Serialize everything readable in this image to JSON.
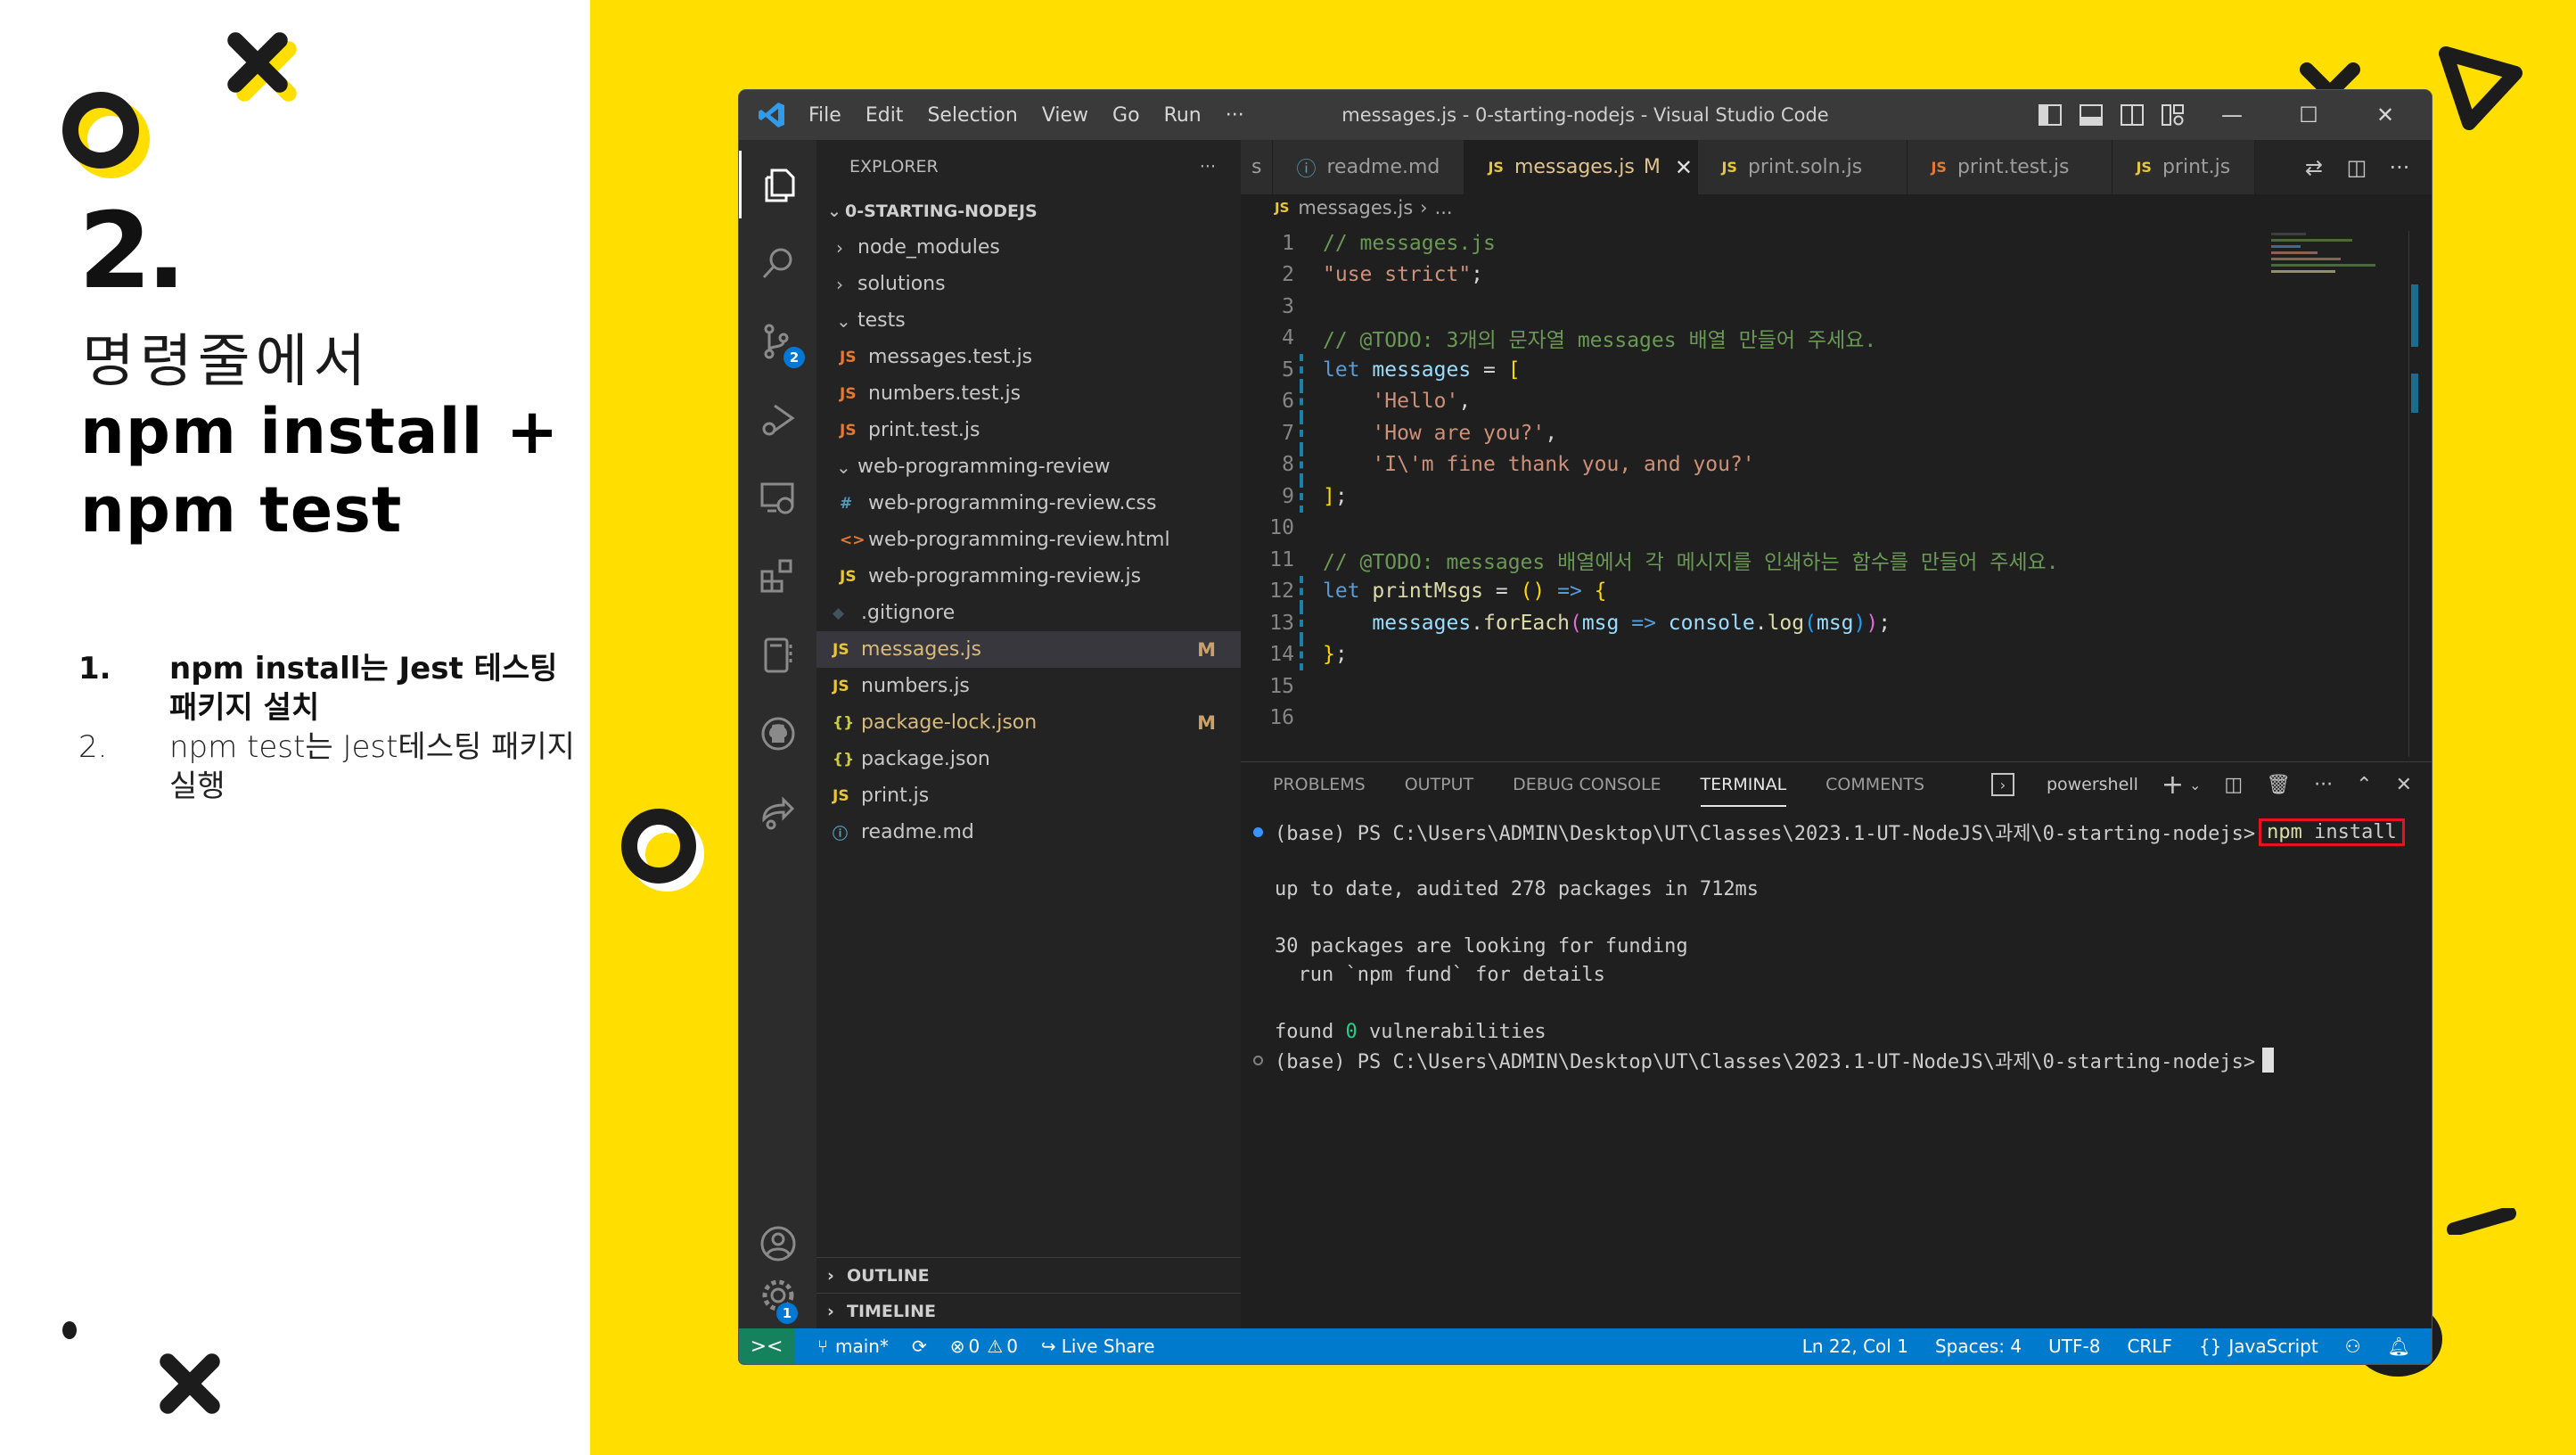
{
  "slide": {
    "number": "2.",
    "subtitle": "명령줄에서",
    "title_lines": [
      "npm install +",
      "npm test"
    ],
    "bullets": [
      {
        "num": "1.",
        "text": "npm install는 Jest 테스팅 패키지 설치",
        "weight": "bold"
      },
      {
        "num": "2.",
        "text": "npm test는 Jest테스팅 패키지 실행",
        "weight": "light"
      }
    ],
    "colors": {
      "background": "#FFDE00",
      "panel": "#FFFFFF",
      "ink": "#1C1C1C"
    }
  },
  "window": {
    "title": "messages.js - 0-starting-nodejs - Visual Studio Code",
    "menu": [
      "File",
      "Edit",
      "Selection",
      "View",
      "Go",
      "Run",
      "···"
    ],
    "controls": {
      "minimize": "—",
      "maximize": "☐",
      "close": "✕"
    }
  },
  "activity_bar": {
    "items": [
      {
        "name": "explorer",
        "active": true
      },
      {
        "name": "search"
      },
      {
        "name": "source-control",
        "badge": "2"
      },
      {
        "name": "run-debug"
      },
      {
        "name": "remote-explorer"
      },
      {
        "name": "extensions"
      },
      {
        "name": "notebook"
      },
      {
        "name": "github"
      },
      {
        "name": "live-share"
      }
    ],
    "bottom": [
      {
        "name": "accounts"
      },
      {
        "name": "manage",
        "badge": "1"
      }
    ]
  },
  "sidebar": {
    "header": "EXPLORER",
    "more": "···",
    "root": "0-STARTING-NODEJS",
    "items": [
      {
        "label": "node_modules",
        "type": "folder",
        "expanded": false,
        "depth": 1
      },
      {
        "label": "solutions",
        "type": "folder",
        "expanded": false,
        "depth": 1
      },
      {
        "label": "tests",
        "type": "folder",
        "expanded": true,
        "depth": 1
      },
      {
        "label": "messages.test.js",
        "type": "jstest",
        "icon": "JS",
        "depth": 2
      },
      {
        "label": "numbers.test.js",
        "type": "jstest",
        "icon": "JS",
        "depth": 2
      },
      {
        "label": "print.test.js",
        "type": "jstest",
        "icon": "JS",
        "depth": 2
      },
      {
        "label": "web-programming-review",
        "type": "folder",
        "expanded": true,
        "depth": 1
      },
      {
        "label": "web-programming-review.css",
        "type": "css",
        "icon": "#",
        "depth": 2
      },
      {
        "label": "web-programming-review.html",
        "type": "html",
        "icon": "<>",
        "depth": 2
      },
      {
        "label": "web-programming-review.js",
        "type": "js",
        "icon": "JS",
        "depth": 2
      },
      {
        "label": ".gitignore",
        "type": "git",
        "icon": "◆",
        "depth": 1
      },
      {
        "label": "messages.js",
        "type": "js",
        "icon": "JS",
        "depth": 1,
        "status": "M",
        "selected": true
      },
      {
        "label": "numbers.js",
        "type": "js",
        "icon": "JS",
        "depth": 1
      },
      {
        "label": "package-lock.json",
        "type": "json",
        "icon": "{}",
        "depth": 1,
        "status": "M"
      },
      {
        "label": "package.json",
        "type": "json",
        "icon": "{}",
        "depth": 1
      },
      {
        "label": "print.js",
        "type": "js",
        "icon": "JS",
        "depth": 1
      },
      {
        "label": "readme.md",
        "type": "info",
        "icon": "ⓘ",
        "depth": 1
      }
    ],
    "sections": [
      "OUTLINE",
      "TIMELINE"
    ]
  },
  "tabs": [
    {
      "label": "readme.md",
      "icon": "ⓘ",
      "type": "info"
    },
    {
      "label": "messages.js",
      "icon": "JS",
      "type": "js",
      "status": "M",
      "active": true
    },
    {
      "label": "print.soln.js",
      "icon": "JS",
      "type": "js"
    },
    {
      "label": "print.test.js",
      "icon": "JS",
      "type": "jstest"
    },
    {
      "label": "print.js",
      "icon": "JS",
      "type": "js"
    }
  ],
  "breadcrumb": {
    "file": "messages.js",
    "rest": "..."
  },
  "code": [
    {
      "n": "1",
      "mod": false,
      "tokens": [
        [
          "c-com",
          "// messages.js"
        ]
      ]
    },
    {
      "n": "2",
      "mod": false,
      "tokens": [
        [
          "c-str",
          "\"use strict\""
        ],
        [
          "c-def",
          ";"
        ]
      ]
    },
    {
      "n": "3",
      "mod": false,
      "tokens": []
    },
    {
      "n": "4",
      "mod": false,
      "tokens": [
        [
          "c-com",
          "// @TODO: 3개의 문자열 messages 배열 만들어 주세요."
        ]
      ]
    },
    {
      "n": "5",
      "mod": true,
      "tokens": [
        [
          "c-kw",
          "let "
        ],
        [
          "c-var",
          "messages"
        ],
        [
          "c-op",
          " = "
        ],
        [
          "c-br1",
          "["
        ]
      ]
    },
    {
      "n": "6",
      "mod": true,
      "tokens": [
        [
          "c-def",
          "    "
        ],
        [
          "c-str",
          "'Hello'"
        ],
        [
          "c-def",
          ","
        ]
      ]
    },
    {
      "n": "7",
      "mod": true,
      "tokens": [
        [
          "c-def",
          "    "
        ],
        [
          "c-str",
          "'How are you?'"
        ],
        [
          "c-def",
          ","
        ]
      ]
    },
    {
      "n": "8",
      "mod": true,
      "tokens": [
        [
          "c-def",
          "    "
        ],
        [
          "c-str",
          "'I\\'m fine thank you, and you?'"
        ]
      ]
    },
    {
      "n": "9",
      "mod": true,
      "tokens": [
        [
          "c-br1",
          "]"
        ],
        [
          "c-def",
          ";"
        ]
      ]
    },
    {
      "n": "10",
      "mod": false,
      "tokens": []
    },
    {
      "n": "11",
      "mod": false,
      "tokens": [
        [
          "c-com",
          "// @TODO: messages 배열에서 각 메시지를 인쇄하는 함수를 만들어 주세요."
        ]
      ]
    },
    {
      "n": "12",
      "mod": true,
      "tokens": [
        [
          "c-kw",
          "let "
        ],
        [
          "c-fn",
          "printMsgs"
        ],
        [
          "c-op",
          " = "
        ],
        [
          "c-br1",
          "()"
        ],
        [
          "c-kw",
          " => "
        ],
        [
          "c-br1",
          "{"
        ]
      ]
    },
    {
      "n": "13",
      "mod": true,
      "tokens": [
        [
          "c-def",
          "    "
        ],
        [
          "c-var",
          "messages"
        ],
        [
          "c-def",
          "."
        ],
        [
          "c-fn",
          "forEach"
        ],
        [
          "c-br2",
          "("
        ],
        [
          "c-var",
          "msg"
        ],
        [
          "c-kw",
          " => "
        ],
        [
          "c-var",
          "console"
        ],
        [
          "c-def",
          "."
        ],
        [
          "c-fn",
          "log"
        ],
        [
          "c-br3",
          "("
        ],
        [
          "c-var",
          "msg"
        ],
        [
          "c-br3",
          ")"
        ],
        [
          "c-br2",
          ")"
        ],
        [
          "c-def",
          ";"
        ]
      ]
    },
    {
      "n": "14",
      "mod": true,
      "tokens": [
        [
          "c-br1",
          "}"
        ],
        [
          "c-def",
          ";"
        ]
      ]
    },
    {
      "n": "15",
      "mod": false,
      "tokens": []
    },
    {
      "n": "16",
      "mod": false,
      "tokens": []
    }
  ],
  "panel": {
    "tabs": [
      "PROBLEMS",
      "OUTPUT",
      "DEBUG CONSOLE",
      "TERMINAL",
      "COMMENTS"
    ],
    "active_tab": "TERMINAL",
    "shell": "powershell",
    "actions": [
      "+",
      "⌄",
      "split",
      "trash",
      "···",
      "^",
      "✕"
    ]
  },
  "terminal": {
    "prompt": "(base) PS C:\\Users\\ADMIN\\Desktop\\UT\\Classes\\2023.1-UT-NodeJS\\과제\\0-starting-nodejs>",
    "command_npm": "npm",
    "command_rest": " install",
    "output": [
      "",
      "up to date, audited 278 packages in 712ms",
      "",
      "30 packages are looking for funding",
      "  run `npm fund` for details",
      ""
    ],
    "found_prefix": "found ",
    "found_count": "0",
    "found_suffix": " vulnerabilities",
    "highlight_color": "#E81123"
  },
  "statusbar": {
    "remote": "><",
    "branch": "main*",
    "sync": "⟳",
    "errors": "0",
    "warnings": "0",
    "live_share": "Live Share",
    "position": "Ln 22, Col 1",
    "spaces": "Spaces: 4",
    "encoding": "UTF-8",
    "eol": "CRLF",
    "language": "JavaScript",
    "color": "#007ACC",
    "remote_color": "#16825D"
  }
}
